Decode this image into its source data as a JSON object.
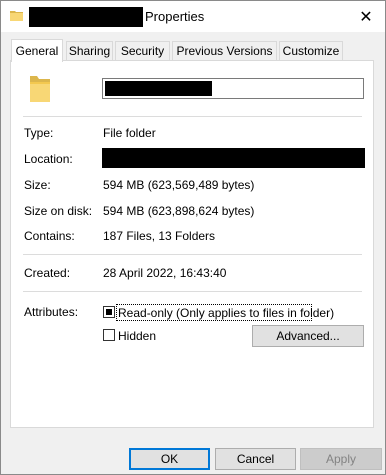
{
  "window": {
    "title_suffix": "Properties",
    "close_glyph": "✕"
  },
  "tabs": [
    {
      "label": "General",
      "active": true
    },
    {
      "label": "Sharing",
      "active": false
    },
    {
      "label": "Security",
      "active": false
    },
    {
      "label": "Previous Versions",
      "active": false
    },
    {
      "label": "Customize",
      "active": false
    }
  ],
  "general": {
    "type_label": "Type:",
    "type_value": "File folder",
    "location_label": "Location:",
    "size_label": "Size:",
    "size_value": "594 MB (623,569,489 bytes)",
    "size_on_disk_label": "Size on disk:",
    "size_on_disk_value": "594 MB (623,898,624 bytes)",
    "contains_label": "Contains:",
    "contains_value": "187 Files, 13 Folders",
    "created_label": "Created:",
    "created_value": "28 April 2022, 16:43:40",
    "attributes_label": "Attributes:",
    "readonly_label": "Read-only (Only applies to files in folder)",
    "readonly_state": "indeterminate",
    "hidden_label": "Hidden",
    "hidden_checked": false,
    "advanced_label": "Advanced..."
  },
  "buttons": {
    "ok": "OK",
    "cancel": "Cancel",
    "apply": "Apply"
  },
  "colors": {
    "folder": "#f8d775",
    "accent": "#0078d7"
  }
}
